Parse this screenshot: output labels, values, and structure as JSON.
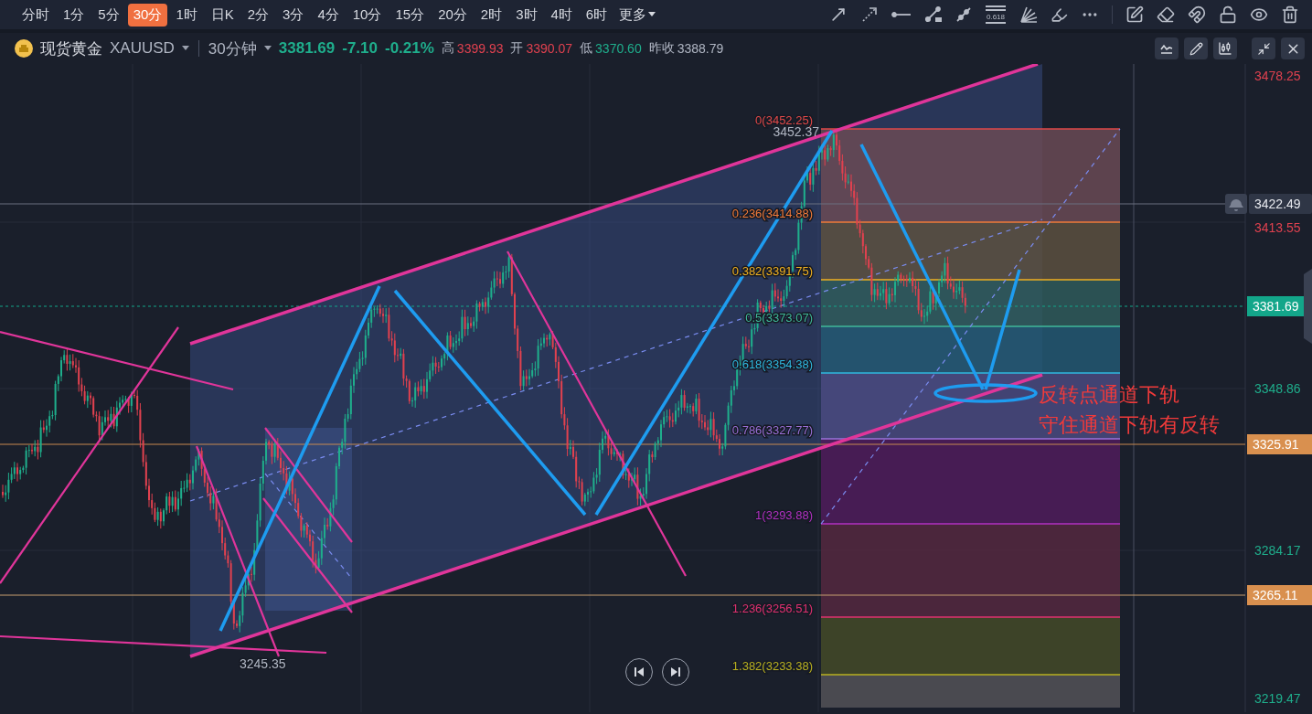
{
  "timeframes": [
    {
      "label": "分时",
      "selected": false
    },
    {
      "label": "1分",
      "selected": false
    },
    {
      "label": "5分",
      "selected": false
    },
    {
      "label": "30分",
      "selected": true
    },
    {
      "label": "1时",
      "selected": false
    },
    {
      "label": "日K",
      "selected": false
    },
    {
      "label": "2分",
      "selected": false
    },
    {
      "label": "3分",
      "selected": false
    },
    {
      "label": "4分",
      "selected": false
    },
    {
      "label": "10分",
      "selected": false
    },
    {
      "label": "15分",
      "selected": false
    },
    {
      "label": "20分",
      "selected": false
    },
    {
      "label": "2时",
      "selected": false
    },
    {
      "label": "3时",
      "selected": false
    },
    {
      "label": "4时",
      "selected": false
    },
    {
      "label": "6时",
      "selected": false
    }
  ],
  "more": "更多",
  "fib_tool_label": "0.618",
  "instrument": {
    "name": "现货黄金",
    "symbol": "XAUUSD",
    "interval": "30分钟",
    "price": "3381.69",
    "change": "-7.10",
    "change_pct": "-0.21%",
    "stats": [
      {
        "label": "高",
        "value": "3399.93",
        "color": "#e0414f"
      },
      {
        "label": "开",
        "value": "3390.07",
        "color": "#e0414f"
      },
      {
        "label": "低",
        "value": "3370.60",
        "color": "#1fae8c"
      },
      {
        "label": "昨收",
        "value": "3388.79",
        "color": "#b0b6c3"
      }
    ]
  },
  "price_axis": [
    {
      "text": "3478.25",
      "kind": "plain",
      "color": "#e0414f"
    },
    {
      "text": "3422.49",
      "kind": "alert",
      "color": "#2f3646"
    },
    {
      "text": "3413.55",
      "kind": "plain",
      "color": "#e0414f"
    },
    {
      "text": "3381.69",
      "kind": "current",
      "color": "#13a68a"
    },
    {
      "text": "3348.86",
      "kind": "plain",
      "color": "#1fae8c"
    },
    {
      "text": "3325.91",
      "kind": "line",
      "color": "#d9904f"
    },
    {
      "text": "3284.17",
      "kind": "plain",
      "color": "#1fae8c"
    },
    {
      "text": "3265.11",
      "kind": "line",
      "color": "#d9904f"
    },
    {
      "text": "3219.47",
      "kind": "plain",
      "color": "#1fae8c"
    }
  ],
  "fib_levels": [
    {
      "label": "0(3452.25)",
      "color": "#e04848"
    },
    {
      "label": "0.236(3414.88)",
      "color": "#f07a3a"
    },
    {
      "label": "0.382(3391.75)",
      "color": "#f0b020"
    },
    {
      "label": "0.5(3373.07)",
      "color": "#3fb89a"
    },
    {
      "label": "0.618(3354.38)",
      "color": "#2fb8e0"
    },
    {
      "label": "0.786(3327.77)",
      "color": "#9a70d8"
    },
    {
      "label": "1(3293.88)",
      "color": "#b030c0"
    },
    {
      "label": "1.236(3256.51)",
      "color": "#e03070"
    },
    {
      "label": "1.382(3233.38)",
      "color": "#b8b020"
    }
  ],
  "price_marks": [
    "3452.37",
    "3245.35"
  ],
  "notes": [
    "反转点通道下轨",
    "守住通道下轨有反转"
  ]
}
